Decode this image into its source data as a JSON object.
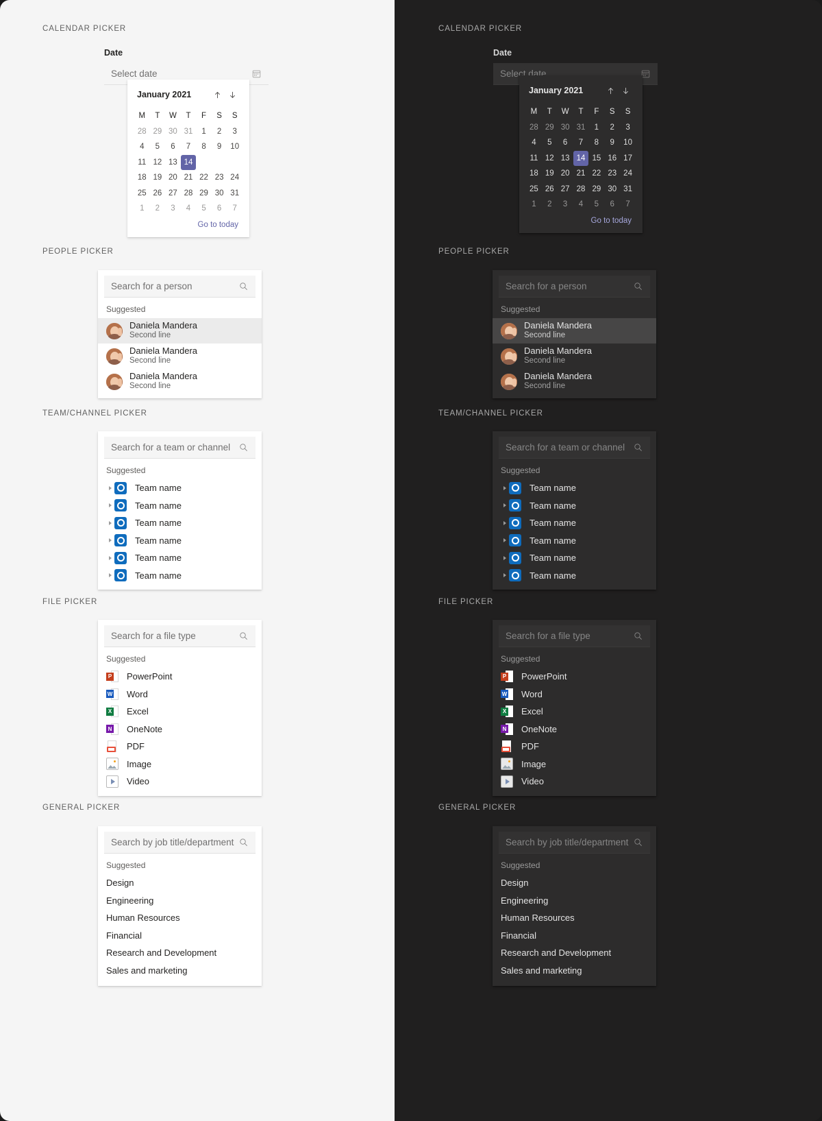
{
  "sections": {
    "calendar": "CALENDAR PICKER",
    "people": "PEOPLE PICKER",
    "team": "TEAM/CHANNEL PICKER",
    "file": "FILE PICKER",
    "general": "GENERAL PICKER"
  },
  "calendar": {
    "field_label": "Date",
    "placeholder": "Select date",
    "calendar_icon": "calendar-icon",
    "title": "January 2021",
    "prev_icon": "arrow-up-icon",
    "next_icon": "arrow-down-icon",
    "weekdays": [
      "M",
      "T",
      "W",
      "T",
      "F",
      "S",
      "S"
    ],
    "days": [
      {
        "n": "28",
        "muted": true
      },
      {
        "n": "29",
        "muted": true
      },
      {
        "n": "30",
        "muted": true
      },
      {
        "n": "31",
        "muted": true
      },
      {
        "n": "1"
      },
      {
        "n": "2"
      },
      {
        "n": "3"
      },
      {
        "n": "4"
      },
      {
        "n": "5"
      },
      {
        "n": "6"
      },
      {
        "n": "7"
      },
      {
        "n": "8"
      },
      {
        "n": "9"
      },
      {
        "n": "10"
      },
      {
        "n": "11"
      },
      {
        "n": "12"
      },
      {
        "n": "13"
      },
      {
        "n": "14",
        "selected": true
      },
      {
        "n": "15",
        "hidden_light": true
      },
      {
        "n": "16",
        "hidden_light": true
      },
      {
        "n": "17",
        "hidden_light": true
      },
      {
        "n": "18"
      },
      {
        "n": "19"
      },
      {
        "n": "20"
      },
      {
        "n": "21"
      },
      {
        "n": "22"
      },
      {
        "n": "23"
      },
      {
        "n": "24"
      },
      {
        "n": "25"
      },
      {
        "n": "26"
      },
      {
        "n": "27"
      },
      {
        "n": "28"
      },
      {
        "n": "29"
      },
      {
        "n": "30"
      },
      {
        "n": "31"
      },
      {
        "n": "1",
        "muted": true
      },
      {
        "n": "2",
        "muted": true
      },
      {
        "n": "3",
        "muted": true
      },
      {
        "n": "4",
        "muted": true
      },
      {
        "n": "5",
        "muted": true
      },
      {
        "n": "6",
        "muted": true
      },
      {
        "n": "7",
        "muted": true
      }
    ],
    "go_to_today": "Go to today",
    "selected_color": "#6264a7"
  },
  "people": {
    "placeholder": "Search for a person",
    "search_icon": "search-icon",
    "suggested_label": "Suggested",
    "items": [
      {
        "name": "Daniela Mandera",
        "sub": "Second line",
        "selected": true
      },
      {
        "name": "Daniela Mandera",
        "sub": "Second line"
      },
      {
        "name": "Daniela Mandera",
        "sub": "Second line"
      }
    ]
  },
  "team": {
    "placeholder": "Search for a team or channel",
    "search_icon": "search-icon",
    "suggested_label": "Suggested",
    "items": [
      {
        "name": "Team name"
      },
      {
        "name": "Team name"
      },
      {
        "name": "Team name"
      },
      {
        "name": "Team name"
      },
      {
        "name": "Team name"
      },
      {
        "name": "Team name"
      }
    ]
  },
  "file": {
    "placeholder": "Search for a file type",
    "search_icon": "search-icon",
    "suggested_label": "Suggested",
    "items": [
      {
        "name": "PowerPoint",
        "icon": "powerpoint-icon",
        "letter": "P",
        "color": "#c43e1c"
      },
      {
        "name": "Word",
        "icon": "word-icon",
        "letter": "W",
        "color": "#185abd"
      },
      {
        "name": "Excel",
        "icon": "excel-icon",
        "letter": "X",
        "color": "#107c41"
      },
      {
        "name": "OneNote",
        "icon": "onenote-icon",
        "letter": "N",
        "color": "#7719aa"
      },
      {
        "name": "PDF",
        "icon": "pdf-icon",
        "letter": "",
        "color": "#e8503a"
      },
      {
        "name": "Image",
        "icon": "image-icon",
        "letter": "",
        "color": "#9aa7b0"
      },
      {
        "name": "Video",
        "icon": "video-icon",
        "letter": "",
        "color": "#7a8fb5"
      }
    ]
  },
  "general": {
    "placeholder": "Search by job title/department",
    "search_icon": "search-icon",
    "suggested_label": "Suggested",
    "items": [
      "Design",
      "Engineering",
      "Human Resources",
      "Financial",
      "Research and Development",
      "Sales and marketing"
    ]
  },
  "theme": {
    "light_bg": "#f5f5f5",
    "dark_bg": "#201f1f",
    "dark_card": "#2d2c2c",
    "accent": "#6264a7"
  }
}
